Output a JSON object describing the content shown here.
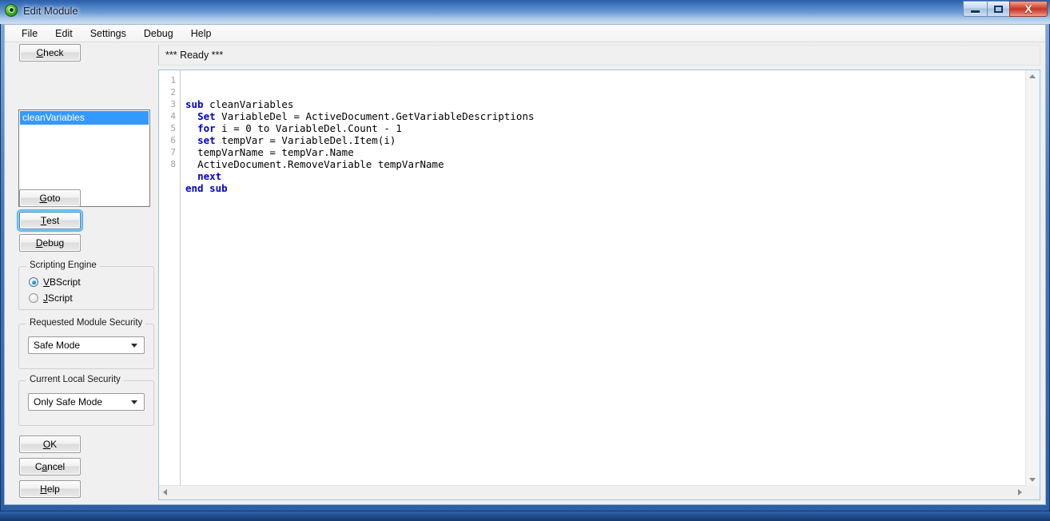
{
  "window": {
    "title": "Edit Module",
    "icon": "app-icon",
    "controls": {
      "minimize": "minimize",
      "maximize": "maximize",
      "close": "X"
    }
  },
  "menubar": {
    "items": [
      {
        "label": "File"
      },
      {
        "label": "Edit"
      },
      {
        "label": "Settings"
      },
      {
        "label": "Debug"
      },
      {
        "label": "Help"
      }
    ]
  },
  "left_panel": {
    "check_button": {
      "mnemonic": "C",
      "rest": "heck"
    },
    "module_list": {
      "items": [
        {
          "label": "cleanVariables",
          "selected": true
        }
      ]
    },
    "goto_button": {
      "mnemonic": "G",
      "rest": "oto"
    },
    "test_button": {
      "mnemonic": "T",
      "rest": "est",
      "focused": true
    },
    "debug_button": {
      "mnemonic": "D",
      "rest": "ebug"
    },
    "scripting_engine": {
      "title": "Scripting Engine",
      "options": [
        {
          "mnemonic": "V",
          "rest": "BScript",
          "checked": true
        },
        {
          "mnemonic": "J",
          "rest": "Script",
          "checked": false
        }
      ]
    },
    "requested_module_security": {
      "title": "Requested Module Security",
      "value": "Safe Mode"
    },
    "current_local_security": {
      "title": "Current Local Security",
      "value": "Only Safe Mode"
    },
    "ok_button": {
      "mnemonic": "O",
      "rest": "K"
    },
    "cancel_button": {
      "pre": "C",
      "mnemonic": "a",
      "rest": "ncel"
    },
    "help_button": {
      "mnemonic": "H",
      "rest": "elp"
    }
  },
  "right_panel": {
    "status": "*** Ready ***",
    "editor": {
      "line_numbers": [
        "1",
        "2",
        "3",
        "4",
        "5",
        "6",
        "7",
        "8"
      ],
      "lines": [
        {
          "indent": "",
          "tokens": [
            {
              "t": "sub",
              "kw": true
            },
            {
              "t": " cleanVariables",
              "kw": false
            }
          ]
        },
        {
          "indent": "  ",
          "tokens": [
            {
              "t": "Set",
              "kw": true
            },
            {
              "t": " VariableDel = ActiveDocument.GetVariableDescriptions",
              "kw": false
            }
          ]
        },
        {
          "indent": "  ",
          "tokens": [
            {
              "t": "for",
              "kw": true
            },
            {
              "t": " i = 0 to VariableDel.Count - 1",
              "kw": false
            }
          ]
        },
        {
          "indent": "  ",
          "tokens": [
            {
              "t": "set",
              "kw": true
            },
            {
              "t": " tempVar = VariableDel.Item(i)",
              "kw": false
            }
          ]
        },
        {
          "indent": "  ",
          "tokens": [
            {
              "t": "tempVarName = tempVar.Name",
              "kw": false
            }
          ]
        },
        {
          "indent": "  ",
          "tokens": [
            {
              "t": "ActiveDocument.RemoveVariable tempVarName",
              "kw": false
            }
          ]
        },
        {
          "indent": "  ",
          "tokens": [
            {
              "t": "next",
              "kw": true
            }
          ]
        },
        {
          "indent": "",
          "tokens": [
            {
              "t": "end sub",
              "kw": true
            }
          ]
        }
      ]
    }
  },
  "colors": {
    "selection_blue": "#3399ff",
    "keyword_blue": "#0000cc",
    "titlebar_blue": "#3e74bd",
    "close_red": "#c1392a",
    "focus_ring": "#5db9f0"
  }
}
